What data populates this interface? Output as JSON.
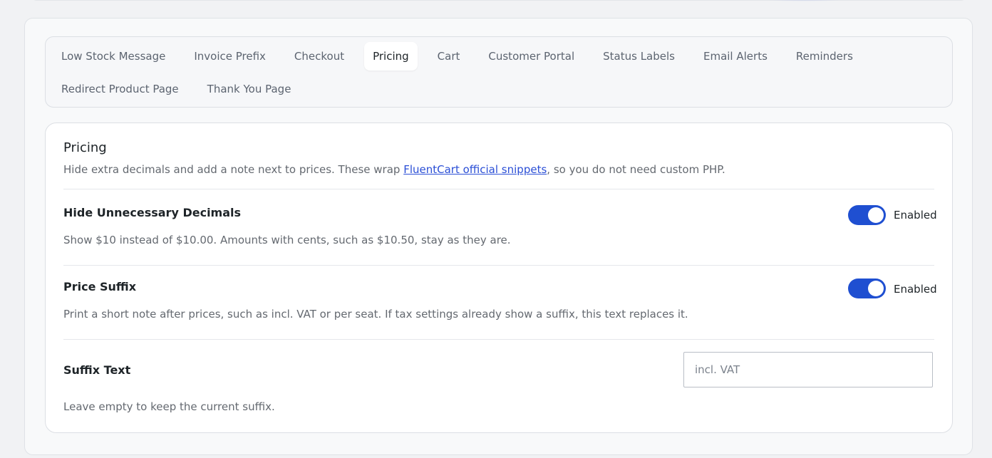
{
  "tabs": [
    {
      "label": "Low Stock Message"
    },
    {
      "label": "Invoice Prefix"
    },
    {
      "label": "Checkout"
    },
    {
      "label": "Pricing"
    },
    {
      "label": "Cart"
    },
    {
      "label": "Customer Portal"
    },
    {
      "label": "Status Labels"
    },
    {
      "label": "Email Alerts"
    },
    {
      "label": "Reminders"
    },
    {
      "label": "Redirect Product Page"
    },
    {
      "label": "Thank You Page"
    }
  ],
  "active_tab": "Pricing",
  "panel": {
    "title": "Pricing",
    "desc_before": "Hide extra decimals and add a note next to prices. These wrap ",
    "desc_link": "FluentCart official snippets",
    "desc_after": ", so you do not need custom PHP."
  },
  "settings": {
    "hide_decimals": {
      "label": "Hide Unnecessary Decimals",
      "enabled": true,
      "toggle_label": "Enabled",
      "help": "Show $10 instead of $10.00. Amounts with cents, such as $10.50, stay as they are."
    },
    "price_suffix": {
      "label": "Price Suffix",
      "enabled": true,
      "toggle_label": "Enabled",
      "help": "Print a short note after prices, such as incl. VAT or per seat. If tax settings already show a suffix, this text replaces it."
    },
    "suffix_text": {
      "label": "Suffix Text",
      "value": "",
      "placeholder": "incl. VAT",
      "help": "Leave empty to keep the current suffix."
    }
  },
  "colors": {
    "accent": "#1f4fd1",
    "link": "#2b4fd6"
  }
}
